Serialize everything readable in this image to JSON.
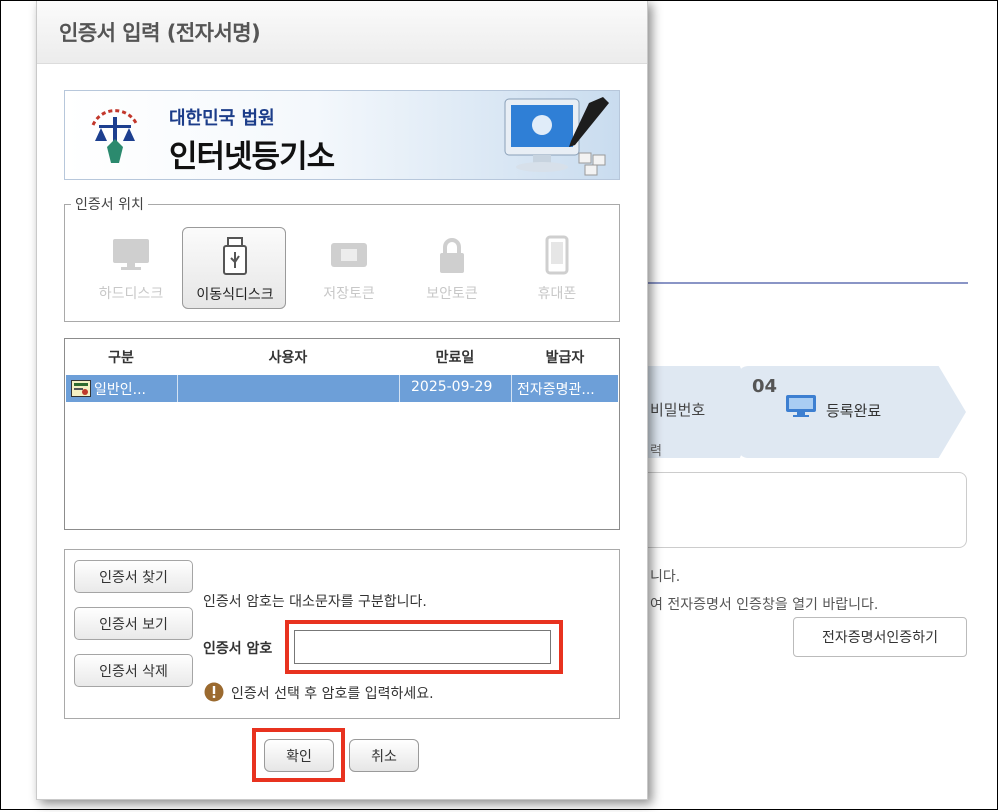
{
  "dialog": {
    "title": "인증서 입력 (전자서명)",
    "banner": {
      "org": "대한민국 법원",
      "name": "인터넷등기소"
    },
    "location": {
      "legend": "인증서 위치",
      "options": [
        {
          "label": "하드디스크",
          "icon": "monitor-icon",
          "active": false
        },
        {
          "label": "이동식디스크",
          "icon": "usb-icon",
          "active": true
        },
        {
          "label": "저장토큰",
          "icon": "chip-icon",
          "active": false
        },
        {
          "label": "보안토큰",
          "icon": "lock-icon",
          "active": false
        },
        {
          "label": "휴대폰",
          "icon": "phone-icon",
          "active": false
        }
      ]
    },
    "table": {
      "headers": [
        "구분",
        "사용자",
        "만료일",
        "발급자"
      ],
      "rows": [
        {
          "type": "일반인...",
          "user": "",
          "expiry": "2025-09-29",
          "issuer": "전자증명관..."
        }
      ]
    },
    "actions": {
      "find": "인증서 찾기",
      "view": "인증서 보기",
      "delete": "인증서 삭제"
    },
    "case_note": "인증서 암호는 대소문자를 구분합니다.",
    "password": {
      "label": "인증서 암호",
      "value": "",
      "placeholder": ""
    },
    "warning": "인증서 선택 후 암호를 입력하세요.",
    "ok": "확인",
    "cancel": "취소"
  },
  "background": {
    "step_prev": {
      "label": "비밀번호",
      "sub": "력"
    },
    "step_current": {
      "num": "04",
      "label": "등록완료"
    },
    "text1": "니다.",
    "text2": "여 전자증명서 인증창을 열기 바랍니다.",
    "button": "전자증명서인증하기"
  },
  "colors": {
    "accent_red": "#e8321f",
    "selection": "#6d9fd8",
    "step_bg": "#dfe8f2"
  }
}
